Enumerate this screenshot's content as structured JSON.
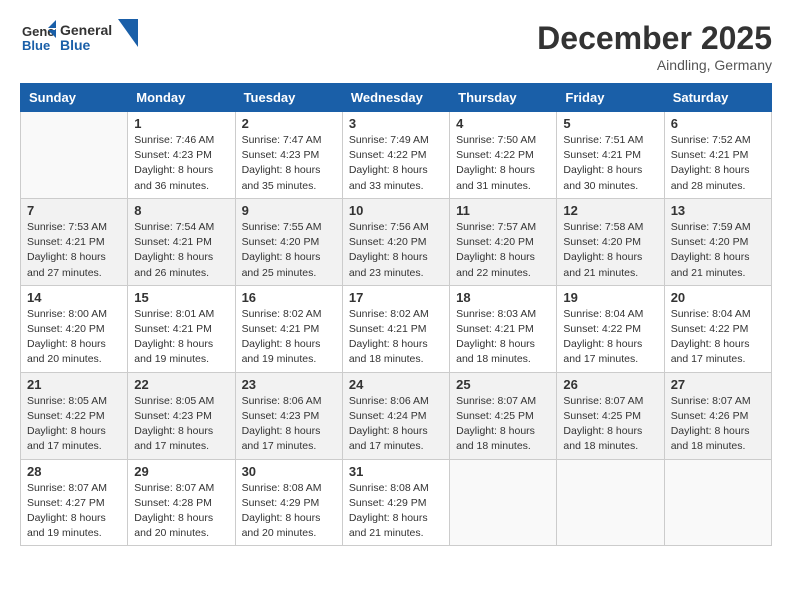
{
  "header": {
    "logo": {
      "general": "General",
      "blue": "Blue"
    },
    "month": "December 2025",
    "location": "Aindling, Germany"
  },
  "weekdays": [
    "Sunday",
    "Monday",
    "Tuesday",
    "Wednesday",
    "Thursday",
    "Friday",
    "Saturday"
  ],
  "weeks": [
    [
      {
        "day": "",
        "info": ""
      },
      {
        "day": "1",
        "info": "Sunrise: 7:46 AM\nSunset: 4:23 PM\nDaylight: 8 hours\nand 36 minutes."
      },
      {
        "day": "2",
        "info": "Sunrise: 7:47 AM\nSunset: 4:23 PM\nDaylight: 8 hours\nand 35 minutes."
      },
      {
        "day": "3",
        "info": "Sunrise: 7:49 AM\nSunset: 4:22 PM\nDaylight: 8 hours\nand 33 minutes."
      },
      {
        "day": "4",
        "info": "Sunrise: 7:50 AM\nSunset: 4:22 PM\nDaylight: 8 hours\nand 31 minutes."
      },
      {
        "day": "5",
        "info": "Sunrise: 7:51 AM\nSunset: 4:21 PM\nDaylight: 8 hours\nand 30 minutes."
      },
      {
        "day": "6",
        "info": "Sunrise: 7:52 AM\nSunset: 4:21 PM\nDaylight: 8 hours\nand 28 minutes."
      }
    ],
    [
      {
        "day": "7",
        "info": "Sunrise: 7:53 AM\nSunset: 4:21 PM\nDaylight: 8 hours\nand 27 minutes."
      },
      {
        "day": "8",
        "info": "Sunrise: 7:54 AM\nSunset: 4:21 PM\nDaylight: 8 hours\nand 26 minutes."
      },
      {
        "day": "9",
        "info": "Sunrise: 7:55 AM\nSunset: 4:20 PM\nDaylight: 8 hours\nand 25 minutes."
      },
      {
        "day": "10",
        "info": "Sunrise: 7:56 AM\nSunset: 4:20 PM\nDaylight: 8 hours\nand 23 minutes."
      },
      {
        "day": "11",
        "info": "Sunrise: 7:57 AM\nSunset: 4:20 PM\nDaylight: 8 hours\nand 22 minutes."
      },
      {
        "day": "12",
        "info": "Sunrise: 7:58 AM\nSunset: 4:20 PM\nDaylight: 8 hours\nand 21 minutes."
      },
      {
        "day": "13",
        "info": "Sunrise: 7:59 AM\nSunset: 4:20 PM\nDaylight: 8 hours\nand 21 minutes."
      }
    ],
    [
      {
        "day": "14",
        "info": "Sunrise: 8:00 AM\nSunset: 4:20 PM\nDaylight: 8 hours\nand 20 minutes."
      },
      {
        "day": "15",
        "info": "Sunrise: 8:01 AM\nSunset: 4:21 PM\nDaylight: 8 hours\nand 19 minutes."
      },
      {
        "day": "16",
        "info": "Sunrise: 8:02 AM\nSunset: 4:21 PM\nDaylight: 8 hours\nand 19 minutes."
      },
      {
        "day": "17",
        "info": "Sunrise: 8:02 AM\nSunset: 4:21 PM\nDaylight: 8 hours\nand 18 minutes."
      },
      {
        "day": "18",
        "info": "Sunrise: 8:03 AM\nSunset: 4:21 PM\nDaylight: 8 hours\nand 18 minutes."
      },
      {
        "day": "19",
        "info": "Sunrise: 8:04 AM\nSunset: 4:22 PM\nDaylight: 8 hours\nand 17 minutes."
      },
      {
        "day": "20",
        "info": "Sunrise: 8:04 AM\nSunset: 4:22 PM\nDaylight: 8 hours\nand 17 minutes."
      }
    ],
    [
      {
        "day": "21",
        "info": "Sunrise: 8:05 AM\nSunset: 4:22 PM\nDaylight: 8 hours\nand 17 minutes."
      },
      {
        "day": "22",
        "info": "Sunrise: 8:05 AM\nSunset: 4:23 PM\nDaylight: 8 hours\nand 17 minutes."
      },
      {
        "day": "23",
        "info": "Sunrise: 8:06 AM\nSunset: 4:23 PM\nDaylight: 8 hours\nand 17 minutes."
      },
      {
        "day": "24",
        "info": "Sunrise: 8:06 AM\nSunset: 4:24 PM\nDaylight: 8 hours\nand 17 minutes."
      },
      {
        "day": "25",
        "info": "Sunrise: 8:07 AM\nSunset: 4:25 PM\nDaylight: 8 hours\nand 18 minutes."
      },
      {
        "day": "26",
        "info": "Sunrise: 8:07 AM\nSunset: 4:25 PM\nDaylight: 8 hours\nand 18 minutes."
      },
      {
        "day": "27",
        "info": "Sunrise: 8:07 AM\nSunset: 4:26 PM\nDaylight: 8 hours\nand 18 minutes."
      }
    ],
    [
      {
        "day": "28",
        "info": "Sunrise: 8:07 AM\nSunset: 4:27 PM\nDaylight: 8 hours\nand 19 minutes."
      },
      {
        "day": "29",
        "info": "Sunrise: 8:07 AM\nSunset: 4:28 PM\nDaylight: 8 hours\nand 20 minutes."
      },
      {
        "day": "30",
        "info": "Sunrise: 8:08 AM\nSunset: 4:29 PM\nDaylight: 8 hours\nand 20 minutes."
      },
      {
        "day": "31",
        "info": "Sunrise: 8:08 AM\nSunset: 4:29 PM\nDaylight: 8 hours\nand 21 minutes."
      },
      {
        "day": "",
        "info": ""
      },
      {
        "day": "",
        "info": ""
      },
      {
        "day": "",
        "info": ""
      }
    ]
  ]
}
